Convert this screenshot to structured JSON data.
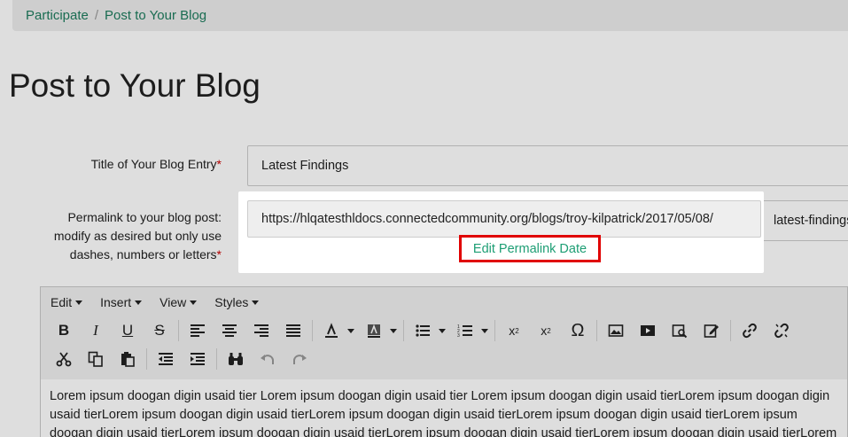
{
  "breadcrumb": {
    "parent": "Participate",
    "separator": "/",
    "current": "Post to Your Blog"
  },
  "page_title": "Post to Your Blog",
  "form": {
    "title_label": "Title of Your Blog Entry",
    "title_value": "Latest Findings",
    "permalink_label_1": "Permalink to your blog post:",
    "permalink_label_2": "modify as desired but only use",
    "permalink_label_3": "dashes, numbers or letters",
    "required_mark": "*",
    "permalink_base": "https://hlqatesthldocs.connectedcommunity.org/blogs/troy-kilpatrick/2017/05/08/",
    "permalink_slug": "latest-findings",
    "edit_permalink_date": "Edit Permalink Date"
  },
  "editor": {
    "menu": [
      "Edit",
      "Insert",
      "View",
      "Styles"
    ],
    "content": "Lorem ipsum doogan digin usaid tier Lorem ipsum doogan digin usaid tier Lorem ipsum doogan digin usaid tierLorem ipsum doogan digin usaid tierLorem ipsum doogan digin usaid tierLorem ipsum doogan digin usaid tierLorem ipsum doogan digin usaid tierLorem ipsum doogan digin usaid tierLorem ipsum doogan digin usaid tierLorem ipsum doogan digin usaid tierLorem ipsum doogan digin usaid tierLorem ipsum doogan digin usaid tierLorem ipsum doogan digin usaid tierLorem ipsum"
  },
  "colors": {
    "link": "#1d7c5e",
    "highlight_border": "#e00000",
    "required": "#cc0000"
  }
}
